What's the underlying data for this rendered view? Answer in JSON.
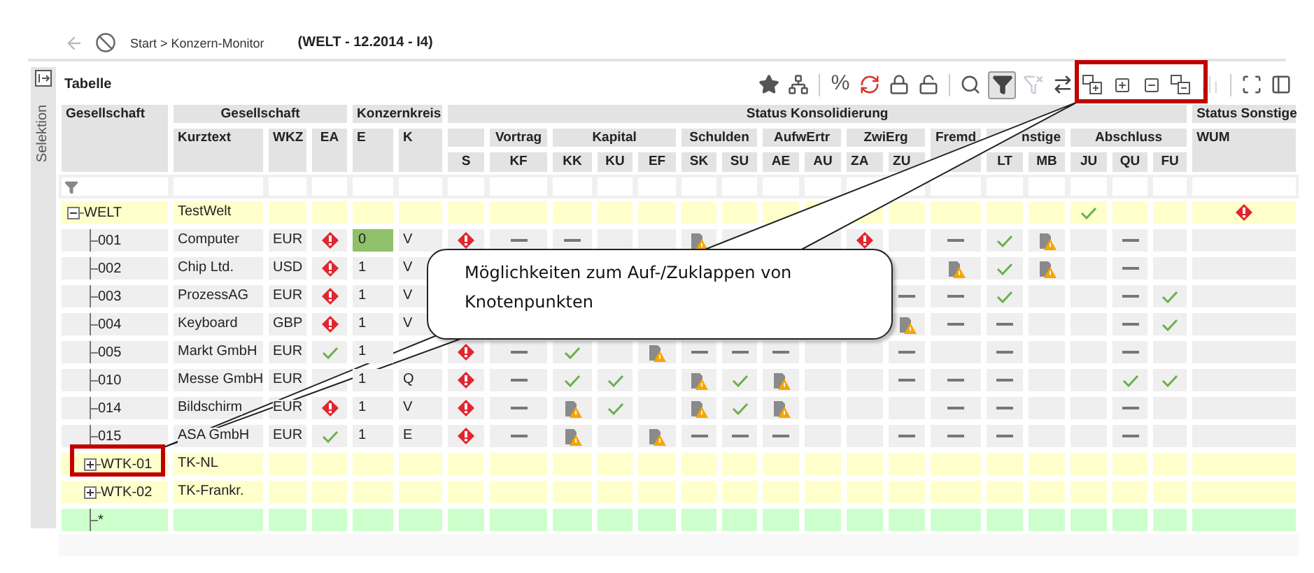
{
  "breadcrumb": {
    "path": "Start > Konzern-Monitor",
    "context": "(WELT - 12.2014 - I4)"
  },
  "sidebar": {
    "label": "Selektion"
  },
  "panel": {
    "title": "Tabelle"
  },
  "toolbar": [
    {
      "kind": "star",
      "disabled": false,
      "selected": false
    },
    {
      "kind": "hierarchy",
      "disabled": false,
      "selected": false
    },
    {
      "kind": "separator"
    },
    {
      "kind": "text",
      "text": "%",
      "disabled": false,
      "selected": false
    },
    {
      "kind": "refresh",
      "disabled": false,
      "selected": false
    },
    {
      "kind": "lock",
      "disabled": false,
      "selected": false
    },
    {
      "kind": "unlock",
      "disabled": false,
      "selected": false
    },
    {
      "kind": "separator"
    },
    {
      "kind": "search",
      "disabled": false,
      "selected": false
    },
    {
      "kind": "filter",
      "disabled": false,
      "selected": true
    },
    {
      "kind": "filter-clear",
      "disabled": true,
      "selected": false
    },
    {
      "kind": "swap",
      "disabled": false,
      "selected": false
    },
    {
      "kind": "expand-all",
      "disabled": false,
      "selected": false
    },
    {
      "kind": "expand",
      "disabled": false,
      "selected": false
    },
    {
      "kind": "collapse",
      "disabled": false,
      "selected": false
    },
    {
      "kind": "collapse-all",
      "disabled": false,
      "selected": false
    },
    {
      "kind": "chart",
      "disabled": true,
      "selected": false
    },
    {
      "kind": "separator"
    },
    {
      "kind": "fullscreen",
      "disabled": false,
      "selected": false
    },
    {
      "kind": "panel",
      "disabled": false,
      "selected": false
    }
  ],
  "header": {
    "top": [
      "Gesellschaft",
      "Gesellschaft",
      "Konzernkreis",
      "Status Konsolidierung",
      "Status Sonstige"
    ],
    "middle": [
      "Kurztext",
      "WKZ",
      "EA",
      "E",
      "K",
      "Vortrag",
      "Kapital",
      "Schulden",
      "AufwErtr",
      "ZwiErg",
      "Fremd",
      "nstige",
      "Abschluss",
      "WUM"
    ],
    "bottom": [
      "S",
      "KF",
      "KK",
      "KU",
      "EF",
      "SK",
      "SU",
      "AE",
      "AU",
      "ZA",
      "ZU",
      "LT",
      "MB",
      "JU",
      "QU",
      "FU"
    ]
  },
  "tree": [
    {
      "kind": "group",
      "code": "WELT",
      "kurztext": "TestWelt",
      "expanded": true,
      "status": {
        "ju": {
          "kind": "ok"
        },
        "wum": {
          "kind": "err"
        }
      },
      "children": [
        {
          "kind": "company",
          "code": "001",
          "kurztext": "Computer",
          "wkz": "EUR",
          "ea": {
            "kind": "err"
          },
          "e": "0",
          "e_highlighted": true,
          "k": "V",
          "status": {
            "s": {
              "kind": "err"
            },
            "kf": {
              "kind": "dash"
            },
            "kk": {
              "kind": "dash"
            },
            "sk": {
              "kind": "warn"
            },
            "za": {
              "kind": "err"
            },
            "fremd": {
              "kind": "dash"
            },
            "lt": {
              "kind": "ok"
            },
            "mb": {
              "kind": "warn"
            },
            "qu": {
              "kind": "dash"
            }
          }
        },
        {
          "kind": "company",
          "code": "002",
          "kurztext": "Chip Ltd.",
          "wkz": "USD",
          "ea": {
            "kind": "err"
          },
          "e": "1",
          "e_highlighted": false,
          "k": "V",
          "status": {
            "fremd": {
              "kind": "warn"
            },
            "lt": {
              "kind": "ok"
            },
            "mb": {
              "kind": "warn"
            },
            "qu": {
              "kind": "dash"
            }
          }
        },
        {
          "kind": "company",
          "code": "003",
          "kurztext": "ProzessAG",
          "wkz": "EUR",
          "ea": {
            "kind": "err"
          },
          "e": "1",
          "e_highlighted": false,
          "k": "V",
          "status": {
            "zu": {
              "kind": "dash"
            },
            "fremd": {
              "kind": "dash"
            },
            "lt": {
              "kind": "ok"
            },
            "qu": {
              "kind": "dash"
            },
            "fu": {
              "kind": "ok"
            }
          }
        },
        {
          "kind": "company",
          "code": "004",
          "kurztext": "Keyboard",
          "wkz": "GBP",
          "ea": {
            "kind": "err"
          },
          "e": "1",
          "e_highlighted": false,
          "k": "V",
          "status": {
            "zu": {
              "kind": "warn"
            },
            "fremd": {
              "kind": "dash"
            },
            "lt": {
              "kind": "dash"
            },
            "qu": {
              "kind": "dash"
            },
            "fu": {
              "kind": "ok"
            }
          }
        },
        {
          "kind": "company",
          "code": "005",
          "kurztext": "Markt GmbH",
          "wkz": "EUR",
          "ea": {
            "kind": "ok"
          },
          "e": "1",
          "e_highlighted": false,
          "status": {
            "s": {
              "kind": "err"
            },
            "kf": {
              "kind": "dash"
            },
            "kk": {
              "kind": "ok"
            },
            "ef": {
              "kind": "warn"
            },
            "sk": {
              "kind": "dash"
            },
            "su": {
              "kind": "dash"
            },
            "ae": {
              "kind": "dash"
            },
            "zu": {
              "kind": "dash"
            },
            "lt": {
              "kind": "dash"
            },
            "qu": {
              "kind": "dash"
            }
          }
        },
        {
          "kind": "company",
          "code": "010",
          "kurztext": "Messe GmbH",
          "wkz": "EUR",
          "e": "1",
          "e_highlighted": false,
          "k": "Q",
          "status": {
            "s": {
              "kind": "err"
            },
            "kf": {
              "kind": "dash"
            },
            "kk": {
              "kind": "ok"
            },
            "ku": {
              "kind": "ok"
            },
            "sk": {
              "kind": "warn"
            },
            "su": {
              "kind": "ok"
            },
            "ae": {
              "kind": "warn"
            },
            "zu": {
              "kind": "dash"
            },
            "fremd": {
              "kind": "dash"
            },
            "lt": {
              "kind": "dash"
            },
            "qu": {
              "kind": "ok"
            },
            "fu": {
              "kind": "ok"
            }
          }
        },
        {
          "kind": "company",
          "code": "014",
          "kurztext": "Bildschirm",
          "wkz": "EUR",
          "ea": {
            "kind": "err"
          },
          "e": "1",
          "e_highlighted": false,
          "k": "V",
          "status": {
            "s": {
              "kind": "err"
            },
            "kf": {
              "kind": "dash"
            },
            "kk": {
              "kind": "warn"
            },
            "ku": {
              "kind": "ok"
            },
            "sk": {
              "kind": "warn"
            },
            "su": {
              "kind": "ok"
            },
            "ae": {
              "kind": "warn"
            },
            "fremd": {
              "kind": "dash"
            },
            "lt": {
              "kind": "dash"
            },
            "qu": {
              "kind": "dash"
            }
          }
        },
        {
          "kind": "company",
          "code": "015",
          "kurztext": "ASA GmbH",
          "wkz": "EUR",
          "ea": {
            "kind": "ok"
          },
          "e": "1",
          "e_highlighted": false,
          "k": "E",
          "status": {
            "s": {
              "kind": "err"
            },
            "kf": {
              "kind": "dash"
            },
            "kk": {
              "kind": "warn"
            },
            "ef": {
              "kind": "warn"
            },
            "sk": {
              "kind": "dash"
            },
            "su": {
              "kind": "dash"
            },
            "ae": {
              "kind": "dash"
            },
            "zu": {
              "kind": "dash"
            },
            "fremd": {
              "kind": "dash"
            },
            "lt": {
              "kind": "dash"
            },
            "qu": {
              "kind": "dash"
            }
          }
        },
        {
          "kind": "group",
          "code": "WTK-01",
          "kurztext": "TK-NL",
          "expanded": false
        },
        {
          "kind": "group",
          "code": "WTK-02",
          "kurztext": "TK-Frankr.",
          "expanded": false
        },
        {
          "kind": "new",
          "code": "*"
        }
      ]
    }
  ],
  "callout": {
    "text": "Möglichkeiten zum Auf-/Zuklappen von Knotenpunkten"
  }
}
